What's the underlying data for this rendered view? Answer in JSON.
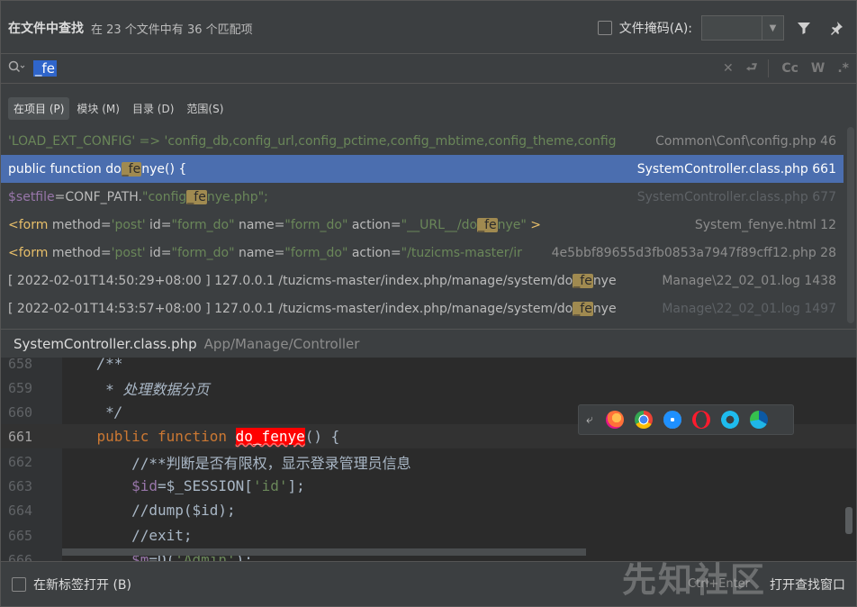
{
  "header": {
    "title": "在文件中查找",
    "summary": "在 23 个文件中有 36 个匹配项",
    "file_mask_label": "文件掩码(A):",
    "file_mask_value": ""
  },
  "search": {
    "query": "_fe",
    "icons": [
      "search-history-icon",
      "clear-icon",
      "replace-toggle-icon",
      "match-case-icon",
      "whole-words-icon",
      "regex-icon"
    ],
    "match_case_label": "Cc",
    "whole_words_label": "W",
    "regex_label": ".*"
  },
  "scope": {
    "options": [
      "在项目 (P)",
      "模块 (M)",
      "目录 (D)",
      "范围(S)"
    ],
    "active": 0
  },
  "results": [
    {
      "pre": "'LOAD_EXT_CONFIG' => ",
      "str": "'config_db,config_url,config_pctime,config_mbtime,config_theme,config",
      "file": "Common\\Conf\\config.php 46"
    },
    {
      "pre": "public function do",
      "hl": "_fe",
      "post": "nye() {",
      "file": "SystemController.class.php 661"
    },
    {
      "var": "$setfile",
      "pre": "=CONF_PATH.",
      "str1": "\"config",
      "hl": "_fe",
      "str2": "nye.php\";",
      "file": "SystemController.class.php 677"
    },
    {
      "tag": "<form",
      "a1": " method=",
      "s1": "'post'",
      "a2": " id=",
      "s2": "\"form_do\"",
      "a3": " name=",
      "s3": "\"form_do\"",
      "a4": " action=",
      "s4a": "\"__URL__/do",
      "hl": "_fe",
      "s4b": "nye\"",
      "end": " >",
      "file": "System_fenye.html 12"
    },
    {
      "tag": "<form",
      "a1": " method=",
      "s1": "'post'",
      "a2": " id=",
      "s2": "\"form_do\"",
      "a3": " name=",
      "s3": "\"form_do\"",
      "a4": " action=",
      "s4a": "\"/tuzicms-master/ir",
      "file": "4e5bbf89655d3fb0853a7947f89cff12.php 28"
    },
    {
      "pre": "[ 2022-02-01T14:50:29+08:00 ] 127.0.0.1 /tuzicms-master/index.php/manage/system/do",
      "hl": "_fe",
      "post": "nye",
      "file": "Manage\\22_02_01.log 1438"
    },
    {
      "pre": "[ 2022-02-01T14:53:57+08:00 ] 127.0.0.1 /tuzicms-master/index.php/manage/system/do",
      "hl": "_fe",
      "post": "nye",
      "file": "Manage\\22_02_01.log 1497"
    }
  ],
  "preview": {
    "file_name": "SystemController.class.php",
    "file_path": "App/Manage/Controller"
  },
  "code": {
    "lines": [
      {
        "n": "658",
        "text": "    /**"
      },
      {
        "n": "659",
        "text": "     * 处理数据分页"
      },
      {
        "n": "660",
        "text": "     */"
      },
      {
        "n": "661",
        "kw1": "    public function ",
        "fn": "do_fenye",
        "rest": "() {"
      },
      {
        "n": "662",
        "text": "        //**判断是否有限权，显示登录管理员信息"
      },
      {
        "n": "663",
        "pre": "        ",
        "v": "$id",
        "mid": "=$_SESSION[",
        "s": "'id'",
        "post": "];"
      },
      {
        "n": "664",
        "text": "        //dump($id);"
      },
      {
        "n": "665",
        "text": "        //exit;"
      },
      {
        "n": "666",
        "pre": "        ",
        "v": "$m",
        "mid": "=D(",
        "s": "'Admin'",
        "post": ");"
      }
    ]
  },
  "browsers": [
    "firefox-icon",
    "chrome-icon",
    "safari-icon",
    "opera-icon",
    "ie-icon",
    "edge-icon"
  ],
  "footer": {
    "new_tab_label": "在新标签打开 (B)",
    "shortcut_hint": "Ctrl+Enter",
    "open_window_label": "打开查找窗口"
  },
  "watermark": "先知社区",
  "colors": {
    "selection": "#4b6eaf",
    "match_highlight": "#a08a50",
    "function_highlight": "#ff0000",
    "string": "#6a8759",
    "keyword": "#cc7832"
  }
}
